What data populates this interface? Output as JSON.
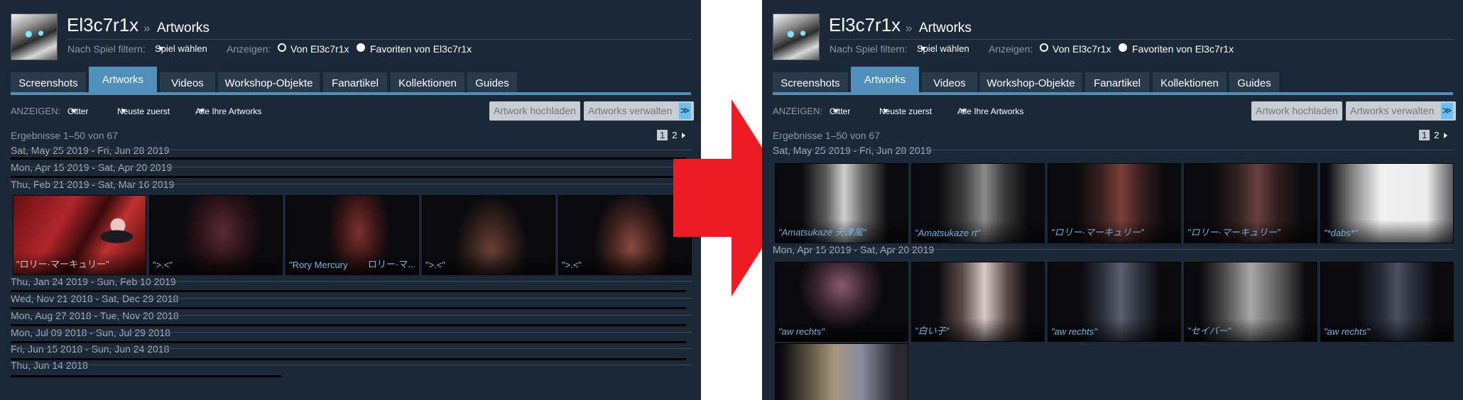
{
  "profile": {
    "name": "El3c7r1x",
    "separator": "»",
    "section": "Artworks"
  },
  "filters": {
    "by_game_label": "Nach Spiel filtern:",
    "game_select": "Spiel wählen",
    "show_label": "Anzeigen:",
    "option_own": "Von El3c7r1x",
    "option_favorites": "Favoriten von El3c7r1x"
  },
  "tabs": [
    "Screenshots",
    "Artworks",
    "Videos",
    "Workshop-Objekte",
    "Fanartikel",
    "Kollektionen",
    "Guides"
  ],
  "active_tab": "Artworks",
  "view": {
    "label": "ANZEIGEN:",
    "layout": "Gitter",
    "sort": "Neuste zuerst",
    "scope": "Alle Ihre Artworks"
  },
  "buttons": {
    "upload": "Artwork hochladen",
    "manage": "Artworks verwalten",
    "manage_dropdown": "≫"
  },
  "results": {
    "text": "Ergebnisse 1–50 von 67",
    "pages": [
      "1",
      "2"
    ]
  },
  "left_panel": {
    "date_groups": [
      "Sat, May 25 2019 - Fri, Jun 28 2019",
      "Mon, Apr 15 2019 - Sat, Apr 20 2019",
      "Thu, Feb 21 2019 - Sat, Mar 16 2019",
      "Thu, Jan 24 2019 - Sun, Feb 10 2019",
      "Wed, Nov 21 2018 - Sat, Dec 29 2018",
      "Mon, Aug 27 2018 - Tue, Nov 20 2018",
      "Mon, Jul 09 2018 - Sun, Jul 29 2018",
      "Fri, Jun 15 2018 - Sun, Jun 24 2018",
      "Thu, Jun 14 2018"
    ],
    "thumbnails": [
      {
        "caption": "\"ロリー·マーキュリー\"",
        "caption2": "",
        "tint": "#8f2323"
      },
      {
        "caption": "\">.<\"",
        "caption2": "",
        "tint": "#5a2a36"
      },
      {
        "caption": "\"Rory Mercury",
        "caption2": "ロリー·マ...",
        "tint": "#7a3030"
      },
      {
        "caption": "\">.<\"",
        "caption2": "",
        "tint": "#6a4038"
      },
      {
        "caption": "\">.<\"",
        "caption2": "",
        "tint": "#8a4a40"
      }
    ]
  },
  "right_panel": {
    "date_groups": [
      "Sat, May 25 2019 - Fri, Jun 28 2019",
      "Mon, Apr 15 2019 - Sat, Apr 20 2019"
    ],
    "row1": [
      {
        "caption": "\"Amatsukaze 天津風\"",
        "tint": "#bdbdbd"
      },
      {
        "caption": "\"Amatsukaze rt\"",
        "tint": "#8a8a8a"
      },
      {
        "caption": "\"ロリー·マーキュリー\"",
        "tint": "#7a4038"
      },
      {
        "caption": "\"ロリー·マーキュリー\"",
        "tint": "#6a4040"
      },
      {
        "caption": "\"*dabs*\"",
        "tint": "#f0f0f0"
      }
    ],
    "row2": [
      {
        "caption": "\"aw rechts\"",
        "tint": "#8a5a6a"
      },
      {
        "caption": "\"白い子\"",
        "tint": "#c8b8b8"
      },
      {
        "caption": "\"aw rechts\"",
        "tint": "#5a6070"
      },
      {
        "caption": "\"セイバー\"",
        "tint": "#a0a0a0"
      },
      {
        "caption": "\"aw rechts\"",
        "tint": "#4a5060"
      }
    ],
    "row3": [
      {
        "caption": "",
        "tint": "#9a8a78"
      }
    ]
  },
  "colors": {
    "background": "#1b2838",
    "accent_tab": "#4f8fba",
    "arrow": "#ed1c24",
    "caption_link": "#6fb2e0"
  },
  "icons": [
    "avatar",
    "radio-empty",
    "radio-filled",
    "caret-down-icon",
    "double-chevron-icon",
    "next-page-icon",
    "right-arrow-icon"
  ]
}
